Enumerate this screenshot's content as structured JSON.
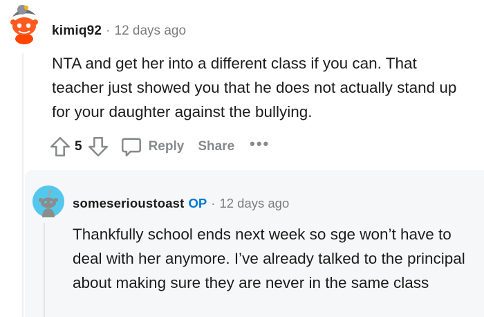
{
  "comment": {
    "username": "kimiq92",
    "separator": "·",
    "timestamp": "12 days ago",
    "body": "NTA and get her into a different class if you can. That teacher just showed you that he does not actually stand up for your daughter against the bullying.",
    "score": "5",
    "reply_label": "Reply",
    "share_label": "Share",
    "more_label": "•••"
  },
  "reply": {
    "username": "someserioustoast",
    "op_badge": "OP",
    "separator": "·",
    "timestamp": "12 days ago",
    "body": "Thankfully school ends next week so sge won’t have to deal with her anymore. I’ve already talked to the principal about making sure they are never in the same class"
  },
  "icons": {
    "upvote": "upvote-arrow-icon",
    "downvote": "downvote-arrow-icon",
    "reply": "speech-bubble-icon",
    "more": "ellipsis-icon",
    "avatar1": "snoo-avatar-icon",
    "avatar2": "snoo-avatar-icon"
  },
  "colors": {
    "op_badge": "#0079d3",
    "meta_text": "#7c7c7c",
    "reply_background": "#f6f7f8",
    "avatar2_background": "#54c7ec"
  }
}
